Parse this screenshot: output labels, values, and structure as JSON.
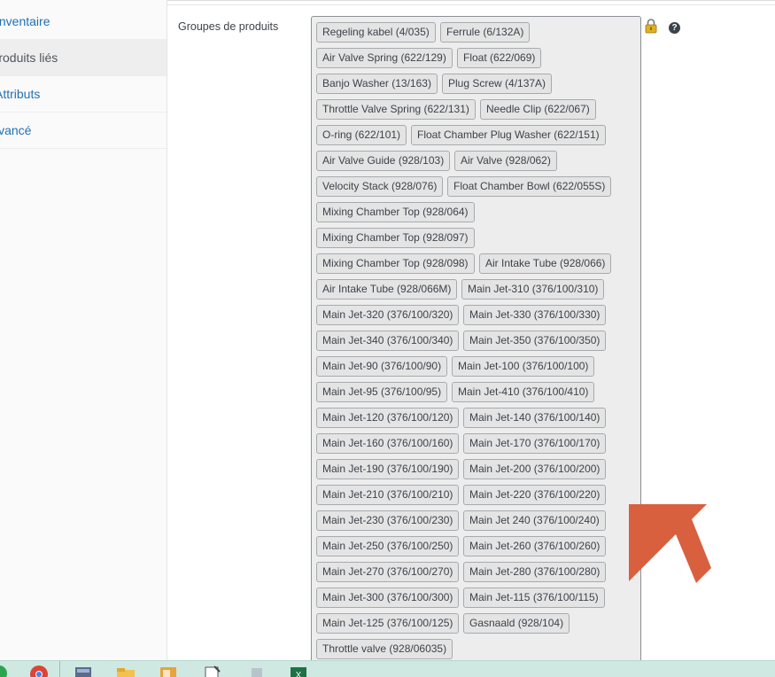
{
  "sidebar": {
    "tabs": [
      {
        "label": "Inventaire",
        "active": false
      },
      {
        "label": "Produits liés",
        "active": true
      },
      {
        "label": "Attributs",
        "active": false
      },
      {
        "label": "Avancé",
        "active": false
      }
    ]
  },
  "field": {
    "label": "Groupes de produits",
    "help_icon": "?"
  },
  "tags": [
    "Regeling kabel (4/035)",
    "Ferrule (6/132A)",
    "Air Valve Spring (622/129)",
    "Float (622/069)",
    "Banjo Washer (13/163)",
    "Plug Screw (4/137A)",
    "Throttle Valve Spring (622/131)",
    "Needle Clip (622/067)",
    "O-ring (622/101)",
    "Float Chamber Plug Washer (622/151)",
    "Air Valve Guide (928/103)",
    "Air Valve (928/062)",
    "Velocity Stack (928/076)",
    "Float Chamber Bowl (622/055S)",
    "Mixing Chamber Top (928/064)",
    "Mixing Chamber Top (928/097)",
    "Mixing Chamber Top (928/098)",
    "Air Intake Tube (928/066)",
    "Air Intake Tube (928/066M)",
    "Main Jet-310 (376/100/310)",
    "Main Jet-320 (376/100/320)",
    "Main Jet-330 (376/100/330)",
    "Main Jet-340 (376/100/340)",
    "Main Jet-350 (376/100/350)",
    "Main Jet-90 (376/100/90)",
    "Main Jet-100 (376/100/100)",
    "Main Jet-95 (376/100/95)",
    "Main Jet-410 (376/100/410)",
    "Main Jet-120 (376/100/120)",
    "Main Jet-140 (376/100/140)",
    "Main Jet-160 (376/100/160)",
    "Main Jet-170 (376/100/170)",
    "Main Jet-190 (376/100/190)",
    "Main Jet-200 (376/100/200)",
    "Main Jet-210 (376/100/210)",
    "Main Jet-220 (376/100/220)",
    "Main Jet-230 (376/100/230)",
    "Main Jet 240 (376/100/240)",
    "Main Jet-250 (376/100/250)",
    "Main Jet-260 (376/100/260)",
    "Main Jet-270 (376/100/270)",
    "Main Jet-280 (376/100/280)",
    "Main Jet-300 (376/100/300)",
    "Main Jet-115 (376/100/115)",
    "Main Jet-125 (376/100/125)",
    "Gasnaald (928/104)",
    "Throttle valve (928/06035)"
  ],
  "colors": {
    "accent_link": "#2271b1",
    "annotation_arrow": "#d9603f",
    "taskbar": "#cfe8e1"
  },
  "taskbar": {
    "icons": [
      "chrome-icon",
      "calculator-icon",
      "file-explorer-icon",
      "outlook-icon",
      "notepad-icon",
      "app-icon",
      "excel-icon"
    ]
  }
}
